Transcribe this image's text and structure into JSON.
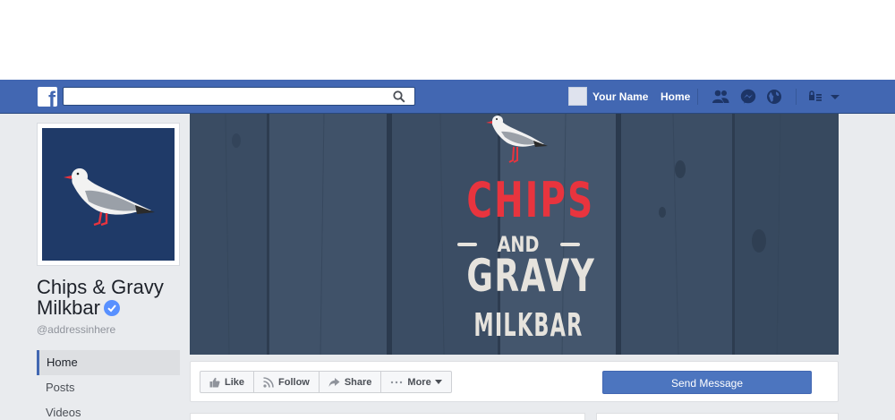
{
  "topbar": {
    "search_placeholder": "",
    "user_name": "Your Name",
    "home_label": "Home",
    "icons": [
      "friends-icon",
      "messenger-icon",
      "globe-icon",
      "privacy-shortcuts-icon",
      "account-menu-caret-icon"
    ]
  },
  "page": {
    "name": "Chips & Gravy Milkbar",
    "handle": "@addressinhere",
    "verified": true
  },
  "cover": {
    "line1": "CHIPS",
    "line2": "AND",
    "line3": "GRAVY",
    "line4": "MILKBAR"
  },
  "sidenav": {
    "items": [
      {
        "label": "Home",
        "active": true
      },
      {
        "label": "Posts",
        "active": false
      },
      {
        "label": "Videos",
        "active": false
      }
    ]
  },
  "actions": {
    "like": "Like",
    "follow": "Follow",
    "share": "Share",
    "more": "More",
    "send_message": "Send Message"
  },
  "colors": {
    "brand_blue": "#4267b2",
    "background_gray": "#e9ebee",
    "logo_navy": "#1f3a68",
    "cover_red": "#e8343e"
  }
}
